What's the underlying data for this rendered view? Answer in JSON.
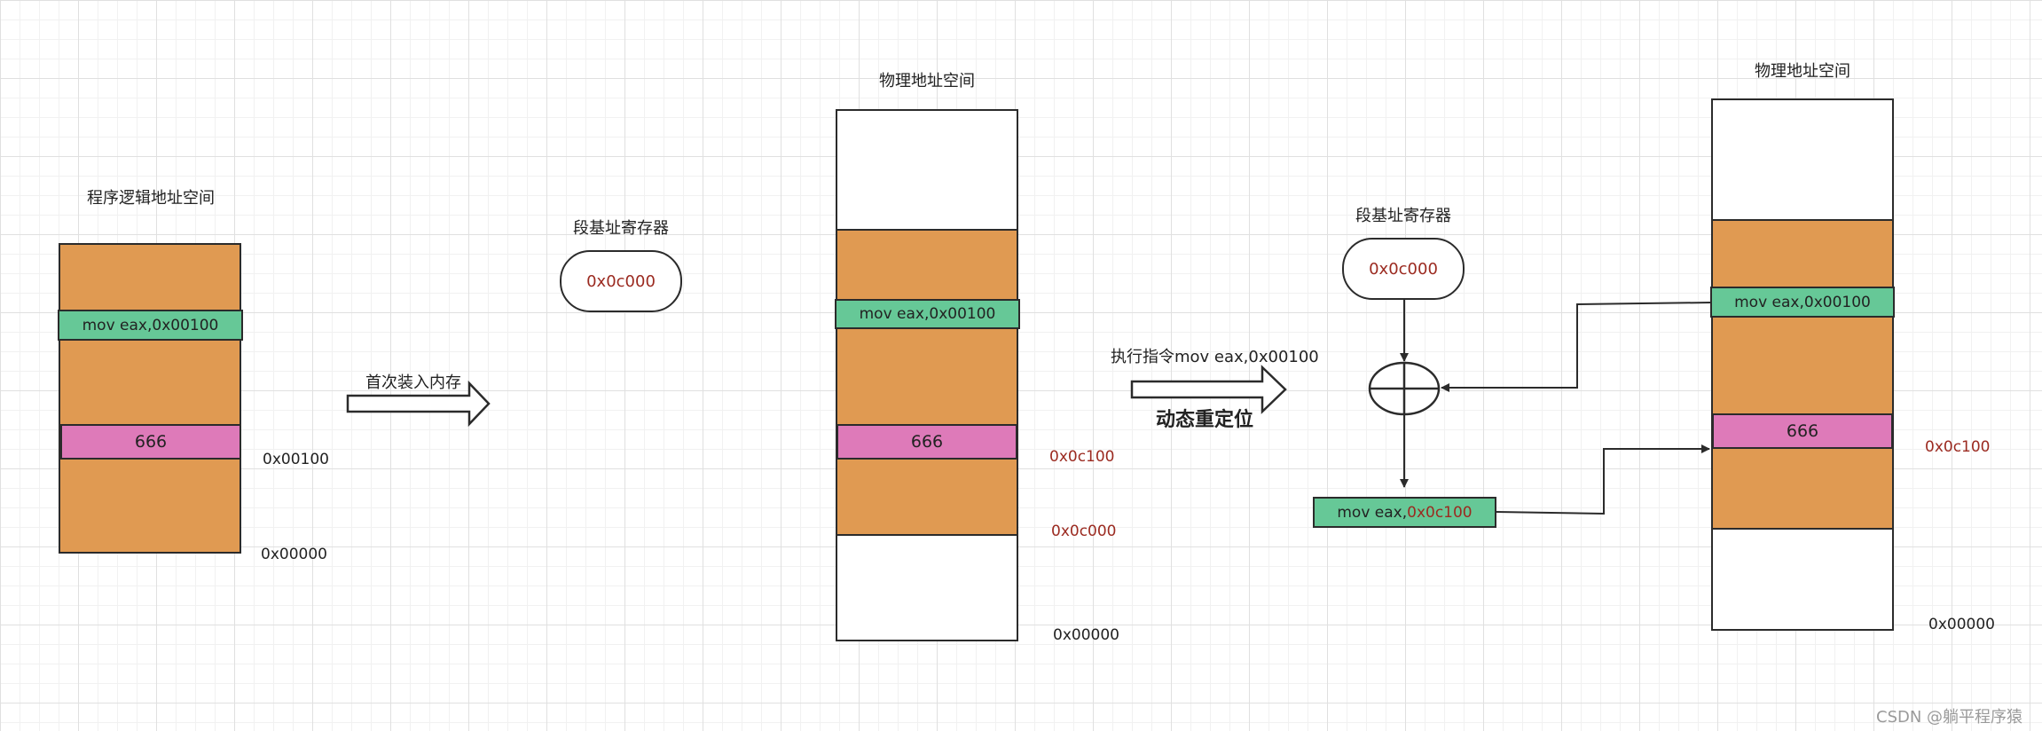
{
  "diagram1": {
    "title": "程序逻辑地址空间",
    "instruction_bar": "mov eax,0x00100",
    "data_bar": "666",
    "addr_high": "0x00100",
    "addr_low": "0x00000"
  },
  "arrow1": {
    "label": "首次装入内存"
  },
  "register1": {
    "title": "段基址寄存器",
    "value": "0x0c000"
  },
  "diagram2": {
    "title": "物理地址空间",
    "instruction_bar": "mov eax,0x00100",
    "data_bar": "666",
    "addr_data": "0x0c100",
    "addr_segment": "0x0c000",
    "addr_low": "0x00000"
  },
  "arrow2": {
    "label_top": "执行指令mov eax,0x00100",
    "label_bottom": "动态重定位"
  },
  "register2": {
    "title": "段基址寄存器",
    "value": "0x0c000"
  },
  "result_bar": {
    "prefix": "mov eax,",
    "value": "0x0c100"
  },
  "diagram3": {
    "title": "物理地址空间",
    "instruction_bar": "mov eax,0x00100",
    "data_bar": "666",
    "addr_data": "0x0c100",
    "addr_low": "0x00000"
  },
  "watermark": "CSDN @躺平程序猿",
  "colors": {
    "segment": "#e09a52",
    "instruction": "#66c897",
    "data": "#de7ab9",
    "address_highlight": "#9b2a20"
  }
}
